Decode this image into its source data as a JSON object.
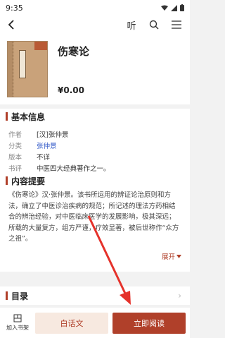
{
  "status": {
    "time": "9:35"
  },
  "nav": {
    "listen_label": "听"
  },
  "book": {
    "title": "伤寒论",
    "price": "¥0.00"
  },
  "basic_info": {
    "heading": "基本信息",
    "rows": [
      {
        "key": "作者",
        "value": "[汉]张仲景"
      },
      {
        "key": "分类",
        "value": "张仲景"
      },
      {
        "key": "版本",
        "value": "不详"
      },
      {
        "key": "书评",
        "value": "中医四大经典著作之一。"
      }
    ]
  },
  "summary": {
    "heading": "内容提要",
    "text": "《伤寒论》汉·张仲景。该书所运用的辨证论治原则和方法，确立了中医诊治疾病的规范；所记述的理法方药相结合的辨治经验，对中医临床医学的发展影响，极其深远；所载的大量复方，组方严谨，疗效显著，被后世称作“众方之祖”。",
    "expand_label": "展开"
  },
  "toc": {
    "heading": "目录"
  },
  "bottom": {
    "shelf_label": "加入书架",
    "vernacular_label": "白话文",
    "read_label": "立即阅读"
  },
  "colors": {
    "accent": "#b0402a",
    "link": "#2e56c7",
    "annotation_arrow": "#e5322b"
  }
}
